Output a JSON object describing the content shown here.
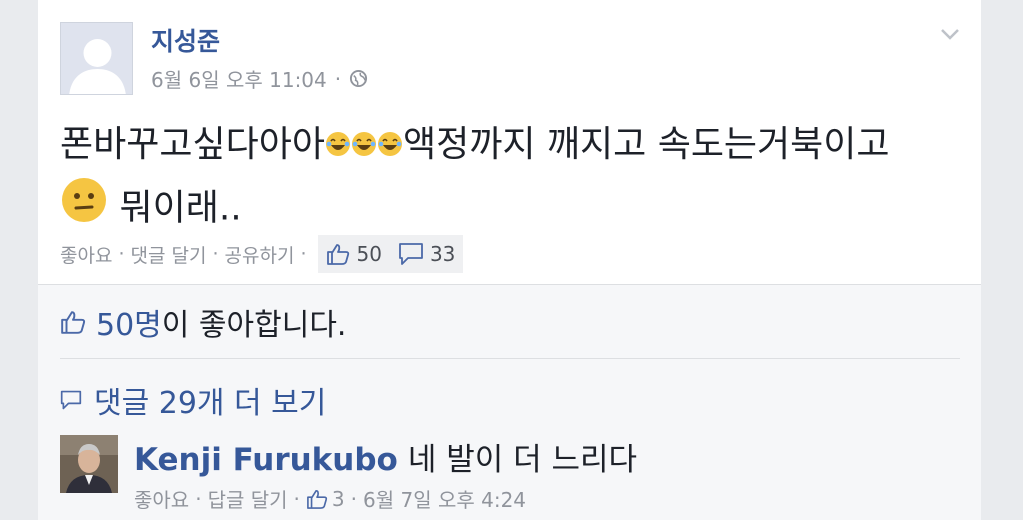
{
  "post": {
    "author": "지성준",
    "timestamp": "6월 6일 오후 11:04",
    "visibility_icon": "globe-icon",
    "text_part1": "폰바꾸고싶다아아",
    "text_part2": "액정까지 깨지고 속도는거북이고",
    "text_part3": "뭐이래..",
    "emoticons": [
      "laughing-tears-emoji",
      "laughing-tears-emoji",
      "laughing-tears-emoji",
      "confused-smile-emoji"
    ],
    "actions": {
      "like": "좋아요",
      "comment": "댓글 달기",
      "share": "공유하기",
      "separator": "·"
    },
    "like_count": "50",
    "comment_count": "33"
  },
  "summary": {
    "likes_count": "50명",
    "likes_suffix": "이 좋아합니다.",
    "view_more": "댓글 29개 더 보기"
  },
  "comment": {
    "author": "Kenji Furukubo",
    "text": "네 발이 더 느리다",
    "actions": {
      "like": "좋아요",
      "reply": "답글 달기",
      "separator": "·"
    },
    "like_count": "3",
    "timestamp": "6월 7일 오후 4:24"
  },
  "colors": {
    "link": "#365899",
    "meta": "#90949c",
    "background": "#e9ebee",
    "emoji": "#f5c542"
  }
}
